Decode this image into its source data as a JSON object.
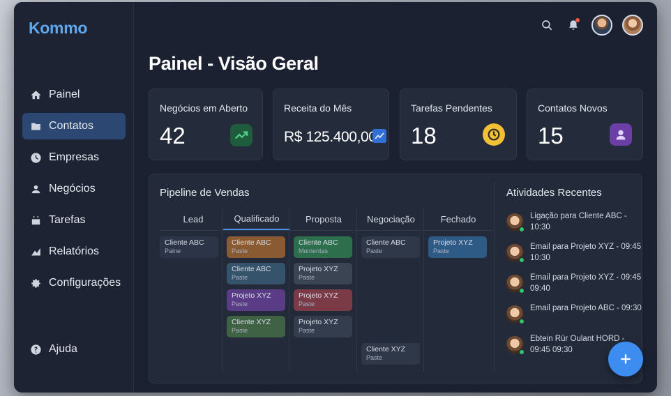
{
  "app": {
    "logo": "Kommo"
  },
  "sidebar": {
    "items": [
      {
        "label": "Painel",
        "icon": "home-icon"
      },
      {
        "label": "Contatos",
        "icon": "folder-icon",
        "active": true
      },
      {
        "label": "Empresas",
        "icon": "building-icon"
      },
      {
        "label": "Negócios",
        "icon": "person-icon"
      },
      {
        "label": "Tarefas",
        "icon": "calendar-icon"
      },
      {
        "label": "Relatórios",
        "icon": "chart-icon"
      },
      {
        "label": "Configurações",
        "icon": "gear-icon"
      }
    ],
    "help": {
      "label": "Ajuda",
      "icon": "help-icon"
    }
  },
  "header": {
    "title": "Painel - Visão Geral"
  },
  "stats": [
    {
      "label": "Negócios em Aberto",
      "value": "42",
      "icon": "trend-up-icon",
      "color": "#1f8a4c"
    },
    {
      "label": "Receita do Mês",
      "value": "R$ 125.400,00",
      "icon": "line-chart-icon",
      "color": "#3b82f6"
    },
    {
      "label": "Tarefas Pendentes",
      "value": "18",
      "icon": "clock-icon",
      "color": "#f2c037"
    },
    {
      "label": "Contatos Novos",
      "value": "15",
      "icon": "user-icon",
      "color": "#9b59d0"
    }
  ],
  "pipeline": {
    "title": "Pipeline de Vendas",
    "columns": [
      {
        "name": "Lead",
        "cards": [
          {
            "name": "Cliente ABC",
            "sub": "Paine",
            "color": "#2c3447"
          }
        ]
      },
      {
        "name": "Qualificado",
        "active": true,
        "cards": [
          {
            "name": "Cliente ABC",
            "sub": "Paste",
            "color": "#8a5a32"
          },
          {
            "name": "Cliente ABC",
            "sub": "Paste",
            "color": "#35536a"
          },
          {
            "name": "Projeto XYZ",
            "sub": "Paste",
            "color": "#5a3c86"
          },
          {
            "name": "Cliente XYZ",
            "sub": "Paste",
            "color": "#3f6245"
          }
        ]
      },
      {
        "name": "Proposta",
        "cards": [
          {
            "name": "Cliente ABC",
            "sub": "Momentas",
            "color": "#2d6e4d"
          },
          {
            "name": "Projeto XYZ",
            "sub": "Paste",
            "color": "#3a4453"
          },
          {
            "name": "Projeto XYZ",
            "sub": "Paste",
            "color": "#7a3a46"
          },
          {
            "name": "Projeto XYZ",
            "sub": "Paste",
            "color": "#343d4e"
          }
        ]
      },
      {
        "name": "Negociação",
        "cards": [
          {
            "name": "Cliente ABC",
            "sub": "Paste",
            "color": "#2f3849"
          },
          {
            "name": "Cliente XYZ",
            "sub": "Paste",
            "color": "#2f3849"
          }
        ]
      },
      {
        "name": "Fechado",
        "cards": [
          {
            "name": "Projeto XYZ",
            "sub": "Paste",
            "color": "#2e5a86"
          }
        ]
      }
    ]
  },
  "activities": {
    "title": "Atividades Recentes",
    "items": [
      {
        "text": "Ligação para Cliente ABC - 10:30"
      },
      {
        "text": "Email para Projeto XYZ - 09:45 10:30"
      },
      {
        "text": "Email para Projeto XYZ - 09:45 09:40"
      },
      {
        "text": "Email para Projeto ABC - 09:30"
      },
      {
        "text": "Ebtein Rür Oulant HORD - 09:45 09:30"
      }
    ]
  },
  "fab": {
    "icon": "plus-icon"
  }
}
